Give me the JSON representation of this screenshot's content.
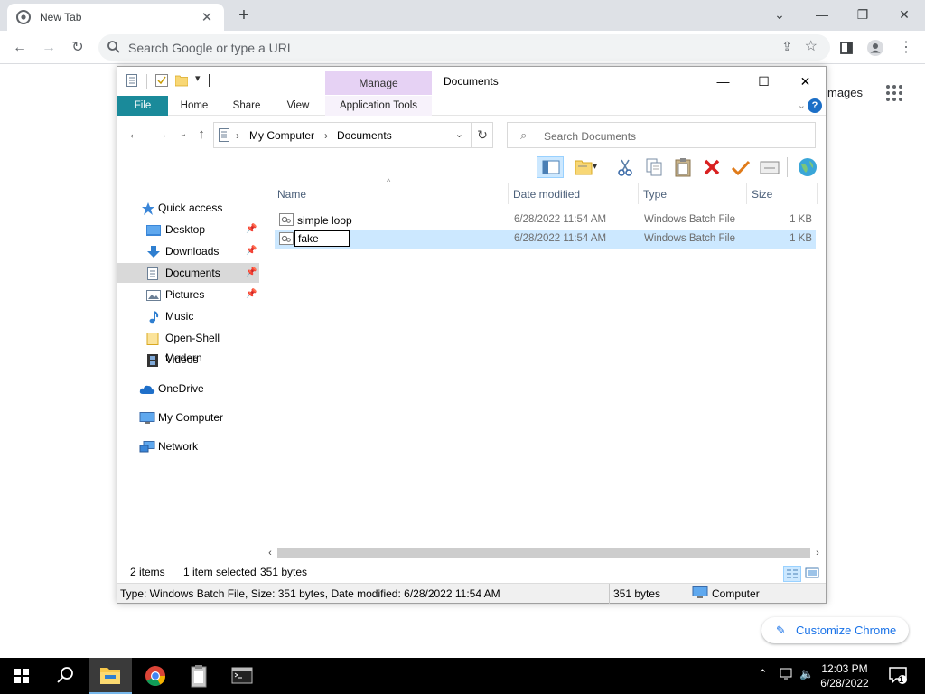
{
  "chrome": {
    "tab_title": "New Tab",
    "omnibox_placeholder": "Search Google or type a URL",
    "ntp_images_label": "mages",
    "customize_label": "Customize Chrome"
  },
  "explorer": {
    "title": "Documents",
    "context_tab": "Manage",
    "ribbon_tabs": [
      "File",
      "Home",
      "Share",
      "View",
      "Application Tools"
    ],
    "address": {
      "root": "My Computer",
      "current": "Documents"
    },
    "search_placeholder": "Search Documents",
    "nav_pane": [
      {
        "label": "Quick access",
        "icon": "star-icon",
        "pinned": false
      },
      {
        "label": "Desktop",
        "icon": "desktop-folder-icon",
        "pinned": true
      },
      {
        "label": "Downloads",
        "icon": "download-arrow-icon",
        "pinned": true
      },
      {
        "label": "Documents",
        "icon": "documents-icon",
        "pinned": true,
        "selected": true
      },
      {
        "label": "Pictures",
        "icon": "pictures-icon",
        "pinned": true
      },
      {
        "label": "Music",
        "icon": "music-note-icon",
        "pinned": false
      },
      {
        "label": "Open-Shell Modern",
        "icon": "folder-icon",
        "pinned": false
      },
      {
        "label": "Videos",
        "icon": "film-icon",
        "pinned": false
      },
      {
        "label": "OneDrive",
        "icon": "cloud-icon",
        "pinned": false
      },
      {
        "label": "My Computer",
        "icon": "computer-icon",
        "pinned": false
      },
      {
        "label": "Network",
        "icon": "network-icon",
        "pinned": false
      }
    ],
    "columns": [
      "Name",
      "Date modified",
      "Type",
      "Size"
    ],
    "files": [
      {
        "name": "simple loop",
        "date": "6/28/2022 11:54 AM",
        "type": "Windows Batch File",
        "size": "1 KB",
        "selected": false
      },
      {
        "name": "",
        "rename_value": "fake",
        "date": "6/28/2022 11:54 AM",
        "type": "Windows Batch File",
        "size": "1 KB",
        "selected": true
      }
    ],
    "status": {
      "item_count": "2 items",
      "selection": "1 item selected",
      "selection_size": "351 bytes",
      "details": "Type: Windows Batch File, Size: 351 bytes, Date modified: 6/28/2022 11:54 AM",
      "size": "351 bytes",
      "location": "Computer"
    }
  },
  "taskbar": {
    "time": "12:03 PM",
    "date": "6/28/2022",
    "notification_count": "1"
  },
  "colors": {
    "file_tab": "#1a8a9a",
    "manage_tab": "#e6d2f4",
    "selection": "#cce8ff",
    "accent_blue": "#1a73e8"
  }
}
